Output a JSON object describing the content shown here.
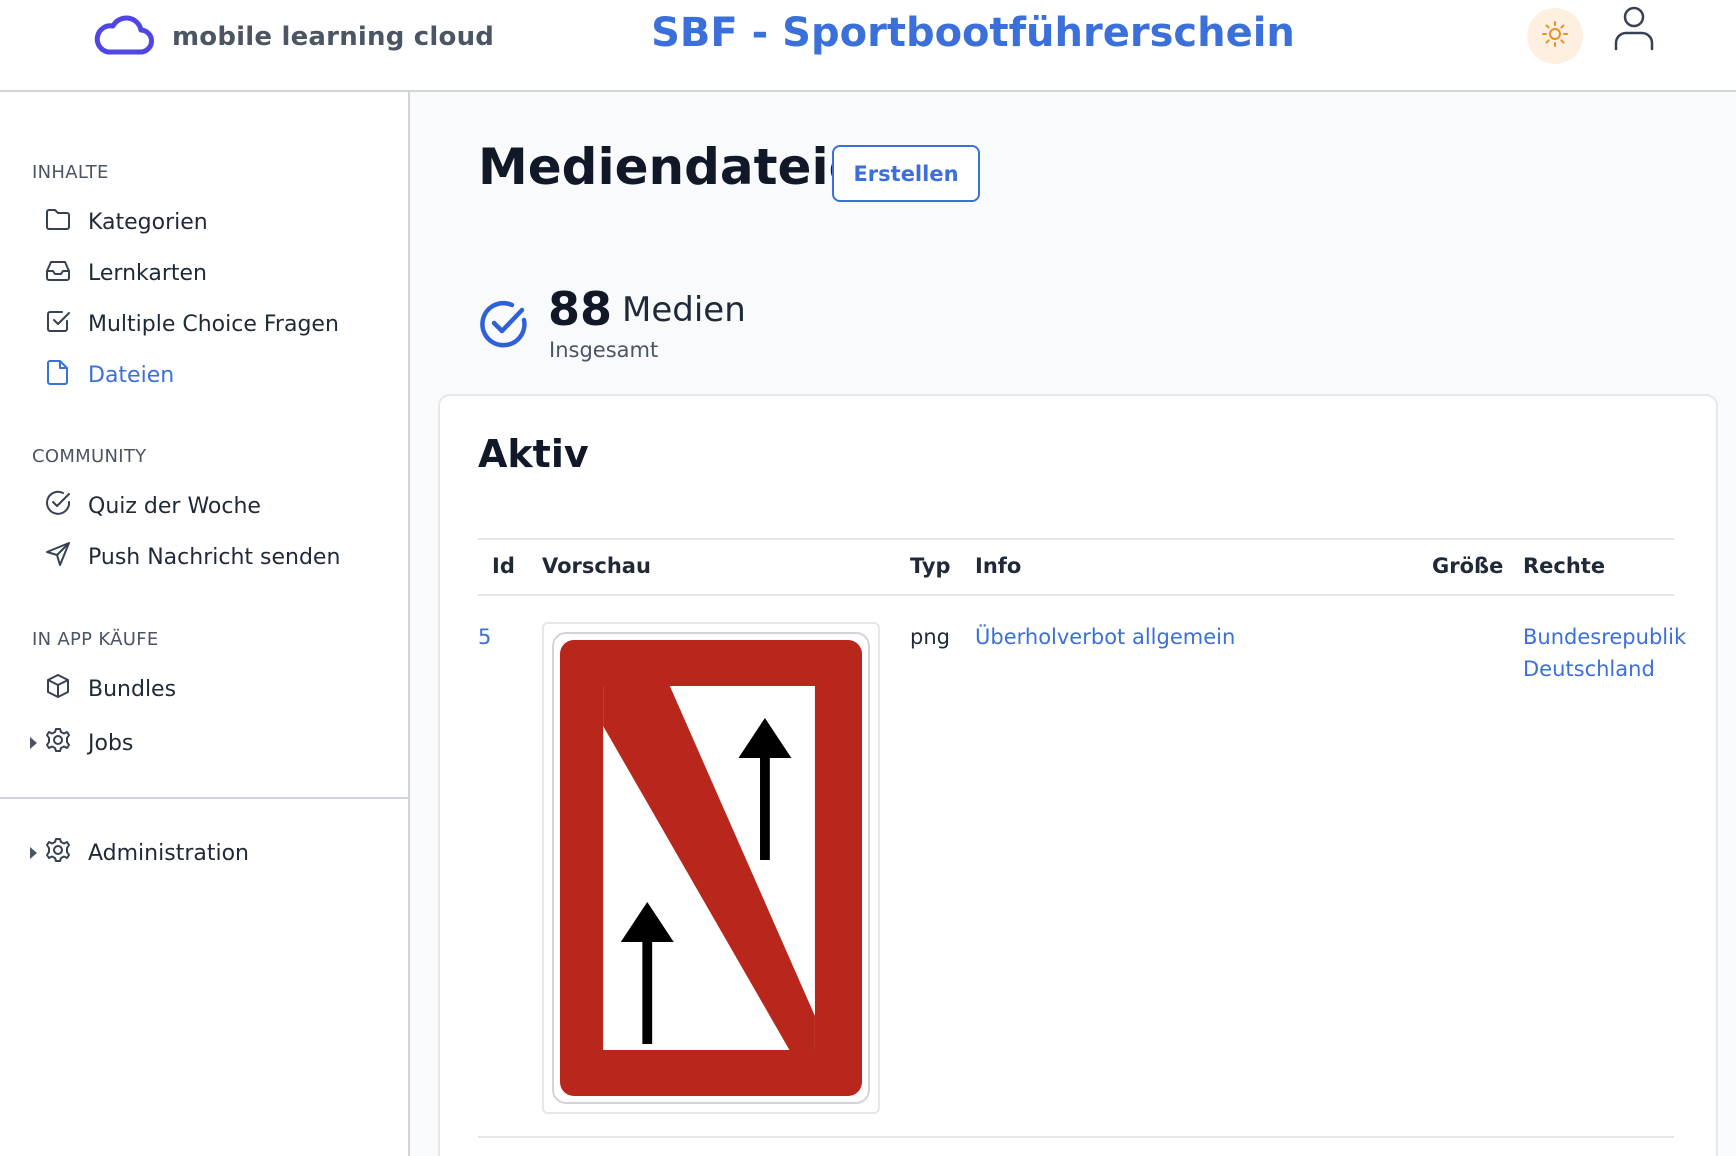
{
  "header": {
    "logo_text": "mobile learning cloud",
    "app_title": "SBF - Sportbootführerschein",
    "theme_icon": "sun-icon",
    "user_icon": "user-icon"
  },
  "sidebar": {
    "sections": [
      {
        "label": "INHALTE",
        "items": [
          {
            "label": "Kategorien",
            "icon": "folder-icon"
          },
          {
            "label": "Lernkarten",
            "icon": "inbox-icon"
          },
          {
            "label": "Multiple Choice Fragen",
            "icon": "checkbox-icon"
          },
          {
            "label": "Dateien",
            "icon": "file-icon",
            "active": true
          }
        ]
      },
      {
        "label": "COMMUNITY",
        "items": [
          {
            "label": "Quiz der Woche",
            "icon": "check-circle-icon"
          },
          {
            "label": "Push Nachricht senden",
            "icon": "send-icon"
          }
        ]
      },
      {
        "label": "IN APP KÄUFE",
        "items": [
          {
            "label": "Bundles",
            "icon": "cube-icon"
          },
          {
            "label": "Jobs",
            "icon": "gear-icon",
            "expandable": true
          }
        ]
      }
    ],
    "admin": {
      "label": "Administration",
      "icon": "gear-icon",
      "expandable": true
    }
  },
  "main": {
    "title": "Mediendateien",
    "create_label": "Erstellen",
    "stats": {
      "count": "88",
      "unit": "Medien",
      "label": "Insgesamt"
    },
    "card_title": "Aktiv",
    "table": {
      "headers": {
        "id": "Id",
        "preview": "Vorschau",
        "type": "Typ",
        "info": "Info",
        "size": "Größe",
        "rights": "Rechte"
      },
      "rows": [
        {
          "id": "5",
          "preview_icon": "overtaking-prohibited-sign-image",
          "type": "png",
          "info": "Überholverbot allgemein",
          "size": "",
          "rights_line1": "Bundesrepublik",
          "rights_line2": "Deutschland"
        }
      ]
    }
  },
  "colors": {
    "accent": "#3b6fd9",
    "logo": "#4f46e5",
    "sign_red": "#b9261b",
    "theme_button_bg": "#fdf0e1",
    "sun": "#e8902b"
  }
}
